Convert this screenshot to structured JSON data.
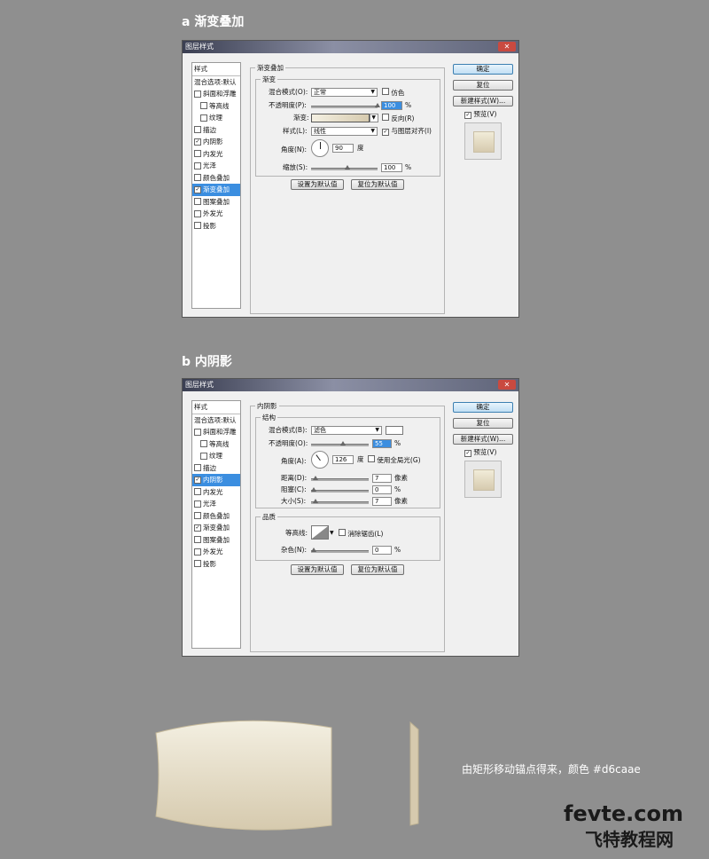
{
  "section_a": {
    "heading": "a  渐变叠加",
    "title": "图层样式",
    "close": "✕",
    "style_list": [
      "样式",
      "混合选项:默认",
      "斜面和浮雕",
      "等高线",
      "纹理",
      "描边",
      "内阴影",
      "内发光",
      "光泽",
      "颜色叠加",
      "渐变叠加",
      "图案叠加",
      "外发光",
      "投影"
    ],
    "group_title": "渐变叠加",
    "subgroup_title": "渐变",
    "blend_label": "混合模式(O):",
    "blend_value": "正常",
    "dither_label": "仿色",
    "opacity_label": "不透明度(P):",
    "opacity_value": "100",
    "percent": "%",
    "gradient_label": "渐变:",
    "reverse_label": "反向(R)",
    "style_label": "样式(L):",
    "style_value": "线性",
    "align_label": "与图层对齐(I)",
    "angle_label": "角度(N):",
    "angle_value": "90",
    "degree": "度",
    "scale_label": "缩放(S):",
    "scale_value": "100",
    "default_btn": "设置为默认值",
    "reset_default_btn": "复位为默认值",
    "ok": "确定",
    "reset": "复位",
    "new_style": "新建样式(W)...",
    "preview": "预览(V)"
  },
  "section_b": {
    "heading": "b  内阴影",
    "title": "图层样式",
    "close": "✕",
    "style_list": [
      "样式",
      "混合选项:默认",
      "斜面和浮雕",
      "等高线",
      "纹理",
      "描边",
      "内阴影",
      "内发光",
      "光泽",
      "颜色叠加",
      "渐变叠加",
      "图案叠加",
      "外发光",
      "投影"
    ],
    "group_title": "内阴影",
    "subgroup_title": "结构",
    "blend_label": "混合模式(B):",
    "blend_value": "滤色",
    "opacity_label": "不透明度(O):",
    "opacity_value": "55",
    "percent": "%",
    "angle_label": "角度(A):",
    "angle_value": "126",
    "degree": "度",
    "global_light": "使用全局光(G)",
    "distance_label": "距离(D):",
    "distance_value": "7",
    "choke_label": "阻塞(C):",
    "choke_value": "0",
    "size_label": "大小(S):",
    "size_value": "7",
    "px": "像素",
    "quality_title": "品质",
    "contour_label": "等高线:",
    "antialias_label": "消除锯齿(L)",
    "noise_label": "杂色(N):",
    "noise_value": "0",
    "default_btn": "设置为默认值",
    "reset_default_btn": "复位为默认值",
    "ok": "确定",
    "reset": "复位",
    "new_style": "新建样式(W)...",
    "preview": "预览(V)"
  },
  "note": "由矩形移动锚点得来，颜色 #d6caae",
  "shape_color": "#d6caae",
  "watermark": {
    "line1": "fevte.com",
    "line2": "飞特教程网"
  }
}
